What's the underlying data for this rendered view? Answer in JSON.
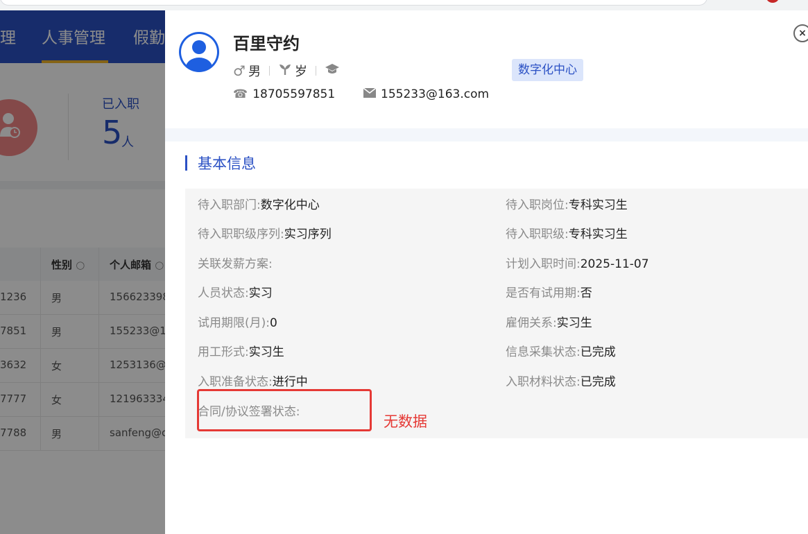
{
  "nav": {
    "items": [
      "理",
      "人事管理",
      "假勤"
    ]
  },
  "summary": {
    "label": "已入职",
    "count": "5",
    "unit": "人"
  },
  "table": {
    "headers": [
      "性别",
      "个人邮箱"
    ],
    "rows": [
      {
        "phone_tail": "1236",
        "gender": "男",
        "email": "156623398"
      },
      {
        "phone_tail": "7851",
        "gender": "男",
        "email": "155233@1"
      },
      {
        "phone_tail": "3632",
        "gender": "女",
        "email": "1253136@"
      },
      {
        "phone_tail": "7777",
        "gender": "女",
        "email": "121963334"
      },
      {
        "phone_tail": "7788",
        "gender": "男",
        "email": "sanfeng@c"
      }
    ]
  },
  "drawer": {
    "close_label": "×",
    "employee": {
      "name": "百里守约",
      "gender": "男",
      "age_label": "岁",
      "department_tag": "数字化中心",
      "phone": "18705597851",
      "email": "155233@163.com"
    },
    "section_title": "基本信息",
    "fields_left": [
      {
        "label": "待入职部门:",
        "value": "数字化中心"
      },
      {
        "label": "待入职职级序列:",
        "value": "实习序列"
      },
      {
        "label": "关联发薪方案:",
        "value": ""
      },
      {
        "label": "人员状态:",
        "value": "实习"
      },
      {
        "label": "试用期限(月):",
        "value": "0"
      },
      {
        "label": "用工形式:",
        "value": "实习生"
      },
      {
        "label": "入职准备状态:",
        "value": "进行中"
      },
      {
        "label": "合同/协议签署状态:",
        "value": ""
      }
    ],
    "fields_right": [
      {
        "label": "待入职岗位:",
        "value": "专科实习生"
      },
      {
        "label": "待入职职级:",
        "value": "专科实习生"
      },
      {
        "label": "计划入职时间:",
        "value": "2025-11-07"
      },
      {
        "label": "是否有试用期:",
        "value": "否"
      },
      {
        "label": "雇佣关系:",
        "value": "实习生"
      },
      {
        "label": "信息采集状态:",
        "value": "已完成"
      },
      {
        "label": "入职材料状态:",
        "value": "已完成"
      }
    ],
    "annotation": "无数据"
  },
  "colors": {
    "brand": "#2b51c4",
    "highlight": "#e53935",
    "tag_bg": "#dbe5fb"
  },
  "icons": [
    "user-avatar-icon",
    "male-icon",
    "sprout-icon",
    "graduation-cap-icon",
    "phone-icon",
    "mail-icon",
    "close-icon",
    "search-icon"
  ]
}
